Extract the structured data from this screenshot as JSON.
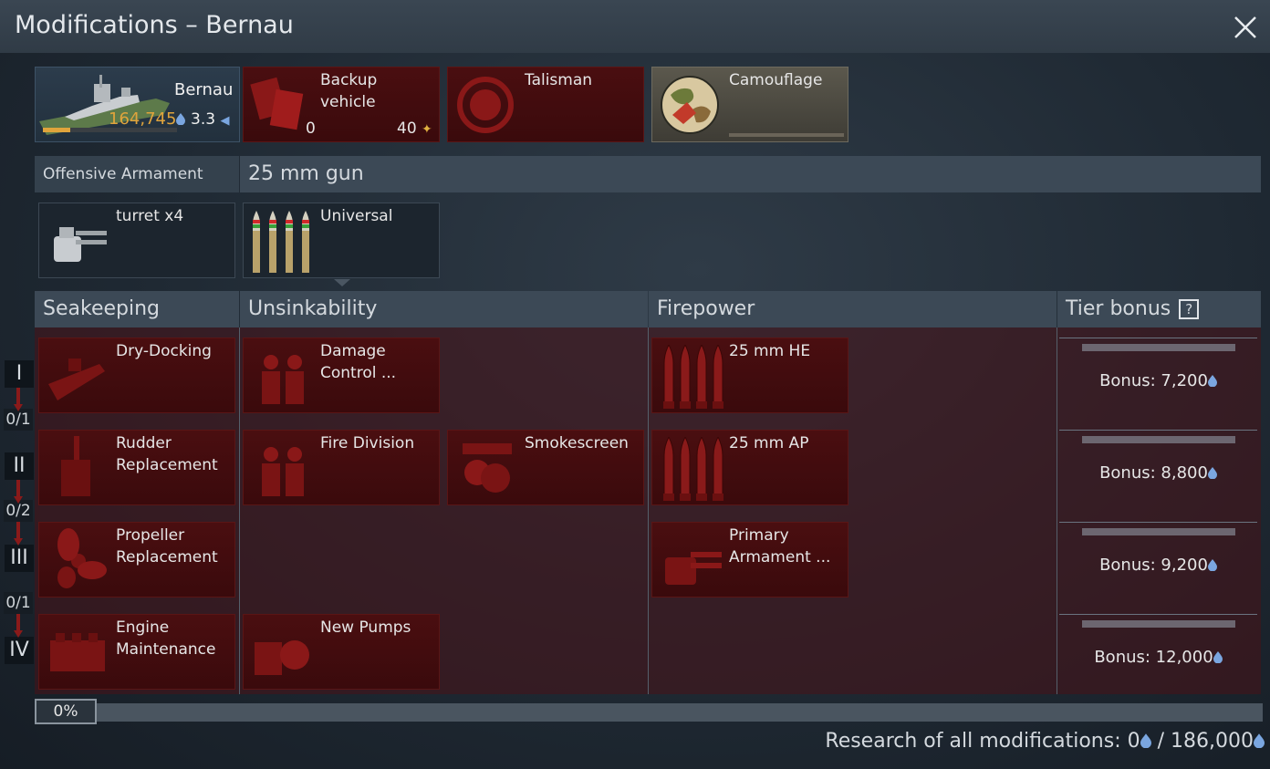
{
  "window": {
    "title": "Modifications – Bernau"
  },
  "vehicle": {
    "name": "Bernau",
    "rp": "164,745",
    "br": "3.3"
  },
  "top_slots": {
    "backup": {
      "label": "Backup vehicle",
      "label_l1": "Backup",
      "label_l2": "vehicle",
      "count": "0",
      "price": "40"
    },
    "talisman": {
      "label": "Talisman"
    },
    "camouflage": {
      "label": "Camouflage"
    }
  },
  "armament": {
    "category": "Offensive Armament",
    "weapon": "25 mm gun",
    "turret_label": "turret x4",
    "ammo_label": "Universal"
  },
  "sections": {
    "seakeeping": "Seakeeping",
    "unsinkability": "Unsinkability",
    "firepower": "Firepower",
    "tier_bonus": "Tier bonus",
    "help_glyph": "?"
  },
  "tiers": [
    "I",
    "II",
    "III",
    "IV"
  ],
  "tier_counts": [
    "0/1",
    "0/2",
    "0/1"
  ],
  "mods": {
    "dry_docking": "Dry-Docking",
    "rudder_l1": "Rudder",
    "rudder_l2": "Replacement",
    "propeller_l1": "Propeller",
    "propeller_l2": "Replacement",
    "engine_l1": "Engine",
    "engine_l2": "Maintenance",
    "damage_l1": "Damage",
    "damage_l2": "Control ...",
    "fire_division": "Fire Division",
    "smokescreen": "Smokescreen",
    "new_pumps": "New Pumps",
    "he": "25 mm HE",
    "ap": "25 mm AP",
    "primary_l1": "Primary",
    "primary_l2": "Armament ..."
  },
  "bonuses": [
    "Bonus: 7,200",
    "Bonus: 8,800",
    "Bonus: 9,200",
    "Bonus: 12,000"
  ],
  "progress": {
    "label": "0%",
    "value": 0
  },
  "research": {
    "prefix": "Research of all modifications: 0",
    "total": "/ 186,000"
  },
  "colors": {
    "accent_red": "#4a0e10",
    "rp_gold": "#e0a43c",
    "rp_blue": "#7aa6e0",
    "header": "#3c4956"
  },
  "icons": [
    "close-icon",
    "ship-icon",
    "backup-icon",
    "talisman-icon",
    "camouflage-icon",
    "turret-icon",
    "ammo-icon",
    "rp-drop-icon",
    "eagle-icon",
    "help-icon"
  ]
}
